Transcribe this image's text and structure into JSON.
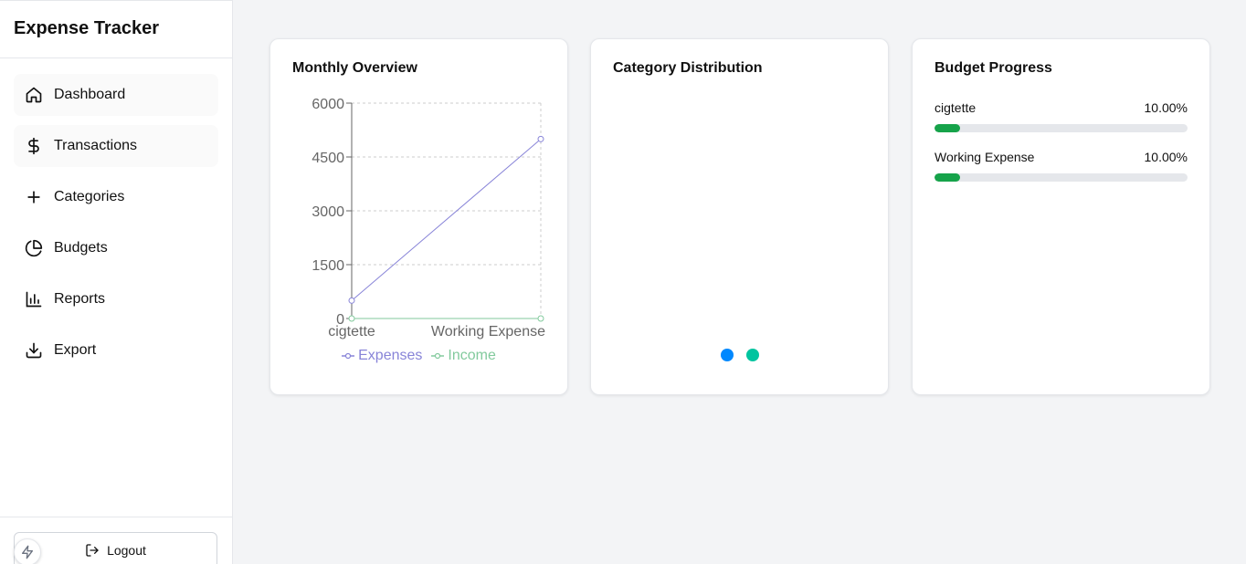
{
  "app": {
    "title": "Expense Tracker"
  },
  "sidebar": {
    "items": [
      {
        "label": "Dashboard",
        "icon": "home-icon"
      },
      {
        "label": "Transactions",
        "icon": "dollar-icon"
      },
      {
        "label": "Categories",
        "icon": "plus-icon"
      },
      {
        "label": "Budgets",
        "icon": "pie-chart-icon"
      },
      {
        "label": "Reports",
        "icon": "bar-chart-icon"
      },
      {
        "label": "Export",
        "icon": "download-icon"
      }
    ],
    "logout_label": "Logout"
  },
  "cards": {
    "monthly_title": "Monthly Overview",
    "category_title": "Category Distribution",
    "budget_title": "Budget Progress"
  },
  "chart_data": {
    "type": "line",
    "x": [
      "cigtette",
      "Working Expense"
    ],
    "y_ticks": [
      "0",
      "1500",
      "3000",
      "4500",
      "6000"
    ],
    "ylim": [
      0,
      6000
    ],
    "grid": true,
    "legend_position": "bottom",
    "series": [
      {
        "name": "Expenses",
        "values": [
          500,
          5000
        ],
        "color": "#8884d8"
      },
      {
        "name": "Income",
        "values": [
          0,
          0
        ],
        "color": "#82ca9d"
      }
    ]
  },
  "category_distribution": {
    "dot_colors": [
      "#0088fe",
      "#00c49f"
    ]
  },
  "budgets": [
    {
      "name": "cigtette",
      "percent_label": "10.00%",
      "progress": 0.1
    },
    {
      "name": "Working Expense",
      "percent_label": "10.00%",
      "progress": 0.1
    }
  ],
  "colors": {
    "accent": "#16a34a",
    "expenses": "#8884d8",
    "income": "#82ca9d"
  }
}
